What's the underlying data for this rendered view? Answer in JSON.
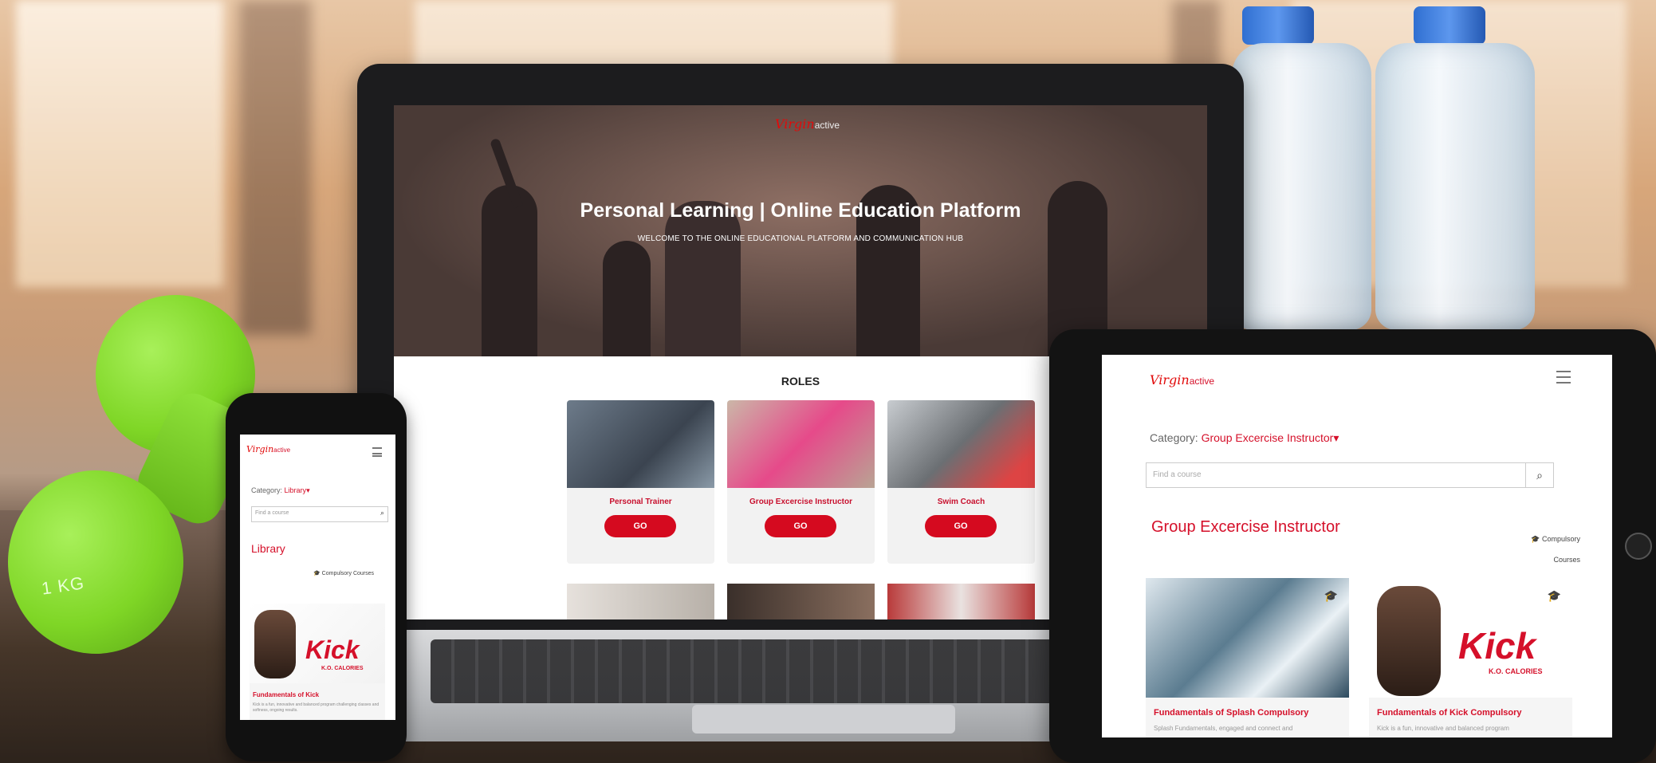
{
  "brand": {
    "logo_script": "Virgin",
    "logo_word": "active"
  },
  "laptop": {
    "hero_title": "Personal Learning | Online Education Platform",
    "hero_subtitle": "WELCOME TO THE ONLINE EDUCATIONAL PLATFORM AND COMMUNICATION HUB",
    "roles_title": "ROLES",
    "roles": [
      {
        "name": "Personal Trainer",
        "button": "GO"
      },
      {
        "name": "Group Excercise Instructor",
        "button": "GO"
      },
      {
        "name": "Swim Coach",
        "button": "GO"
      }
    ]
  },
  "phone": {
    "category_label": "Category:",
    "category_value": "Library",
    "search_placeholder": "Find a course",
    "section_title": "Library",
    "compulsory_label": "Compulsory Courses",
    "card_kick": "Kick",
    "card_kick_sub": "K.O. CALORIES",
    "card_title": "Fundamentals of Kick",
    "card_desc": "Kick is a fun, innovative and balanced program challenging classes and softness, ongoing results."
  },
  "tablet": {
    "category_label": "Category:",
    "category_value": "Group Excercise Instructor",
    "search_placeholder": "Find a course",
    "section_title": "Group Excercise Instructor",
    "compulsory_label_1": "Compulsory",
    "compulsory_label_2": "Courses",
    "courses": [
      {
        "title": "Fundamentals of Splash Compulsory",
        "desc": "Splash Fundamentals, engaged and connect and"
      },
      {
        "title": "Fundamentals of Kick Compulsory",
        "desc": "Kick is a fun, innovative and balanced program",
        "kick": "Kick",
        "kick_sub": "K.O. CALORIES"
      }
    ]
  },
  "dumbbell": {
    "weight_label": "1 KG"
  },
  "colors": {
    "brand_red": "#d50a1f",
    "dumbbell_green": "#7fd626",
    "bottle_cap": "#2f6fd1"
  },
  "icons": [
    "search-icon",
    "hamburger-menu-icon",
    "graduation-cap-icon",
    "caret-down-icon"
  ]
}
